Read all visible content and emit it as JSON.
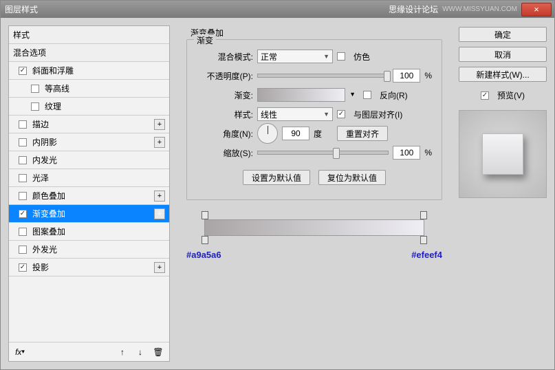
{
  "titlebar": {
    "title": "图层样式",
    "forum": "思缘设计论坛",
    "url": "WWW.MISSYUAN.COM"
  },
  "left": {
    "styles_header": "样式",
    "blend_header": "混合选项",
    "items": [
      {
        "label": "斜面和浮雕",
        "checked": true,
        "plus": false
      },
      {
        "label": "等高线",
        "checked": false,
        "plus": false,
        "sub": true
      },
      {
        "label": "纹理",
        "checked": false,
        "plus": false,
        "sub": true
      },
      {
        "label": "描边",
        "checked": false,
        "plus": true
      },
      {
        "label": "内阴影",
        "checked": false,
        "plus": true
      },
      {
        "label": "内发光",
        "checked": false,
        "plus": false
      },
      {
        "label": "光泽",
        "checked": false,
        "plus": false
      },
      {
        "label": "颜色叠加",
        "checked": false,
        "plus": true
      },
      {
        "label": "渐变叠加",
        "checked": true,
        "plus": true,
        "selected": true
      },
      {
        "label": "图案叠加",
        "checked": false,
        "plus": false
      },
      {
        "label": "外发光",
        "checked": false,
        "plus": false
      },
      {
        "label": "投影",
        "checked": true,
        "plus": true
      }
    ],
    "footer": {
      "fx": "fx"
    }
  },
  "mid": {
    "section_title": "渐变叠加",
    "group_title": "渐变",
    "blend_mode_label": "混合模式:",
    "blend_mode_value": "正常",
    "dither_label": "仿色",
    "opacity_label": "不透明度(P):",
    "opacity_value": "100",
    "percent": "%",
    "gradient_label": "渐变:",
    "reverse_label": "反向(R)",
    "style_label": "样式:",
    "style_value": "线性",
    "align_label": "与图层对齐(I)",
    "angle_label": "角度(N):",
    "angle_value": "90",
    "degree": "度",
    "reset_align": "重置对齐",
    "scale_label": "缩放(S):",
    "scale_value": "100",
    "set_default": "设置为默认值",
    "reset_default": "复位为默认值",
    "color_left": "#a9a5a6",
    "color_right": "#efeef4"
  },
  "right": {
    "ok": "确定",
    "cancel": "取消",
    "new_style": "新建样式(W)...",
    "preview_label": "预览(V)"
  }
}
